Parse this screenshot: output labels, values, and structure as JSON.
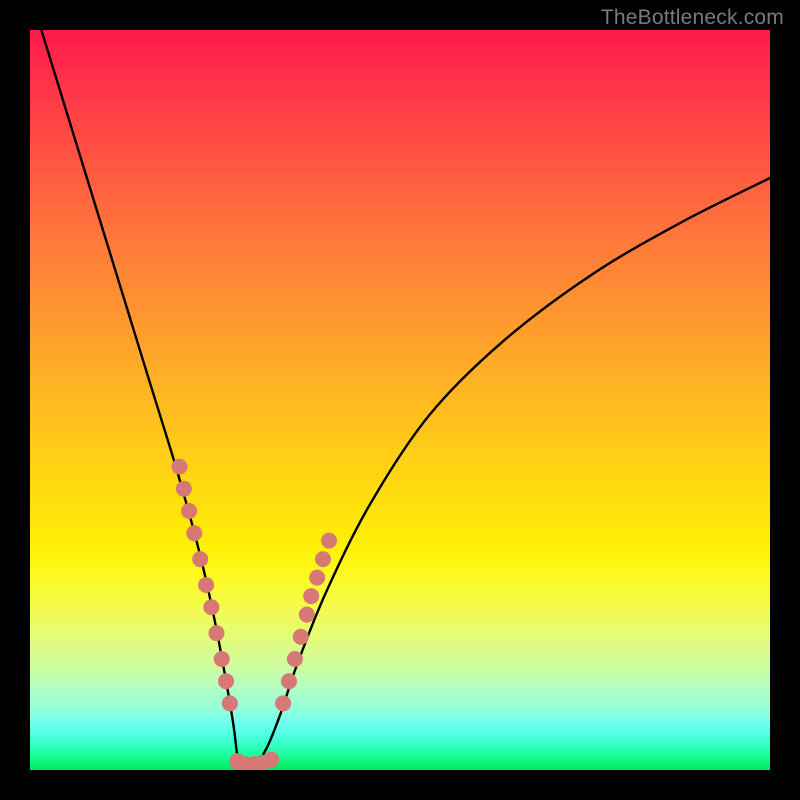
{
  "watermark": {
    "text": "TheBottleneck.com"
  },
  "chart_data": {
    "type": "line",
    "title": "",
    "xlabel": "",
    "ylabel": "",
    "xlim": [
      0,
      100
    ],
    "ylim": [
      0,
      100
    ],
    "grid": false,
    "legend": false,
    "series": [
      {
        "name": "bottleneck-curve",
        "x": [
          0,
          4,
          8,
          12,
          16,
          20,
          23,
          25,
          26.5,
          27.5,
          28,
          28.5,
          29,
          30,
          32,
          34,
          36,
          40,
          46,
          54,
          64,
          76,
          88,
          100
        ],
        "y": [
          105,
          92,
          79,
          66,
          53,
          40,
          29,
          20,
          12,
          6,
          2,
          0,
          0,
          0,
          3,
          8,
          14,
          24,
          36,
          48,
          58,
          67,
          74,
          80
        ],
        "stroke": "#000000",
        "stroke_width": 2.4
      }
    ],
    "points": [
      {
        "name": "left-cluster",
        "color": "#d67873",
        "radius": 8,
        "xy": [
          [
            20.2,
            41
          ],
          [
            20.8,
            38
          ],
          [
            21.5,
            35
          ],
          [
            22.2,
            32
          ],
          [
            23.0,
            28.5
          ],
          [
            23.8,
            25
          ],
          [
            24.5,
            22
          ],
          [
            25.2,
            18.5
          ],
          [
            25.9,
            15
          ],
          [
            26.5,
            12
          ],
          [
            27.0,
            9
          ]
        ]
      },
      {
        "name": "bottom-cluster",
        "color": "#d67873",
        "radius": 8,
        "xy": [
          [
            28.0,
            1.2
          ],
          [
            29.0,
            0.8
          ],
          [
            30.2,
            0.8
          ],
          [
            31.4,
            1.0
          ],
          [
            32.6,
            1.4
          ]
        ]
      },
      {
        "name": "right-cluster",
        "color": "#d67873",
        "radius": 8,
        "xy": [
          [
            34.2,
            9
          ],
          [
            35.0,
            12
          ],
          [
            35.8,
            15
          ],
          [
            36.6,
            18
          ],
          [
            37.4,
            21
          ],
          [
            38.0,
            23.5
          ],
          [
            38.8,
            26
          ],
          [
            39.6,
            28.5
          ],
          [
            40.4,
            31
          ]
        ]
      }
    ],
    "background_gradient": {
      "direction": "vertical",
      "stops": [
        {
          "pos": 0,
          "color": "#ff1a4a"
        },
        {
          "pos": 50,
          "color": "#ffc41b"
        },
        {
          "pos": 75,
          "color": "#f3fb4d"
        },
        {
          "pos": 100,
          "color": "#00e85c"
        }
      ]
    }
  }
}
